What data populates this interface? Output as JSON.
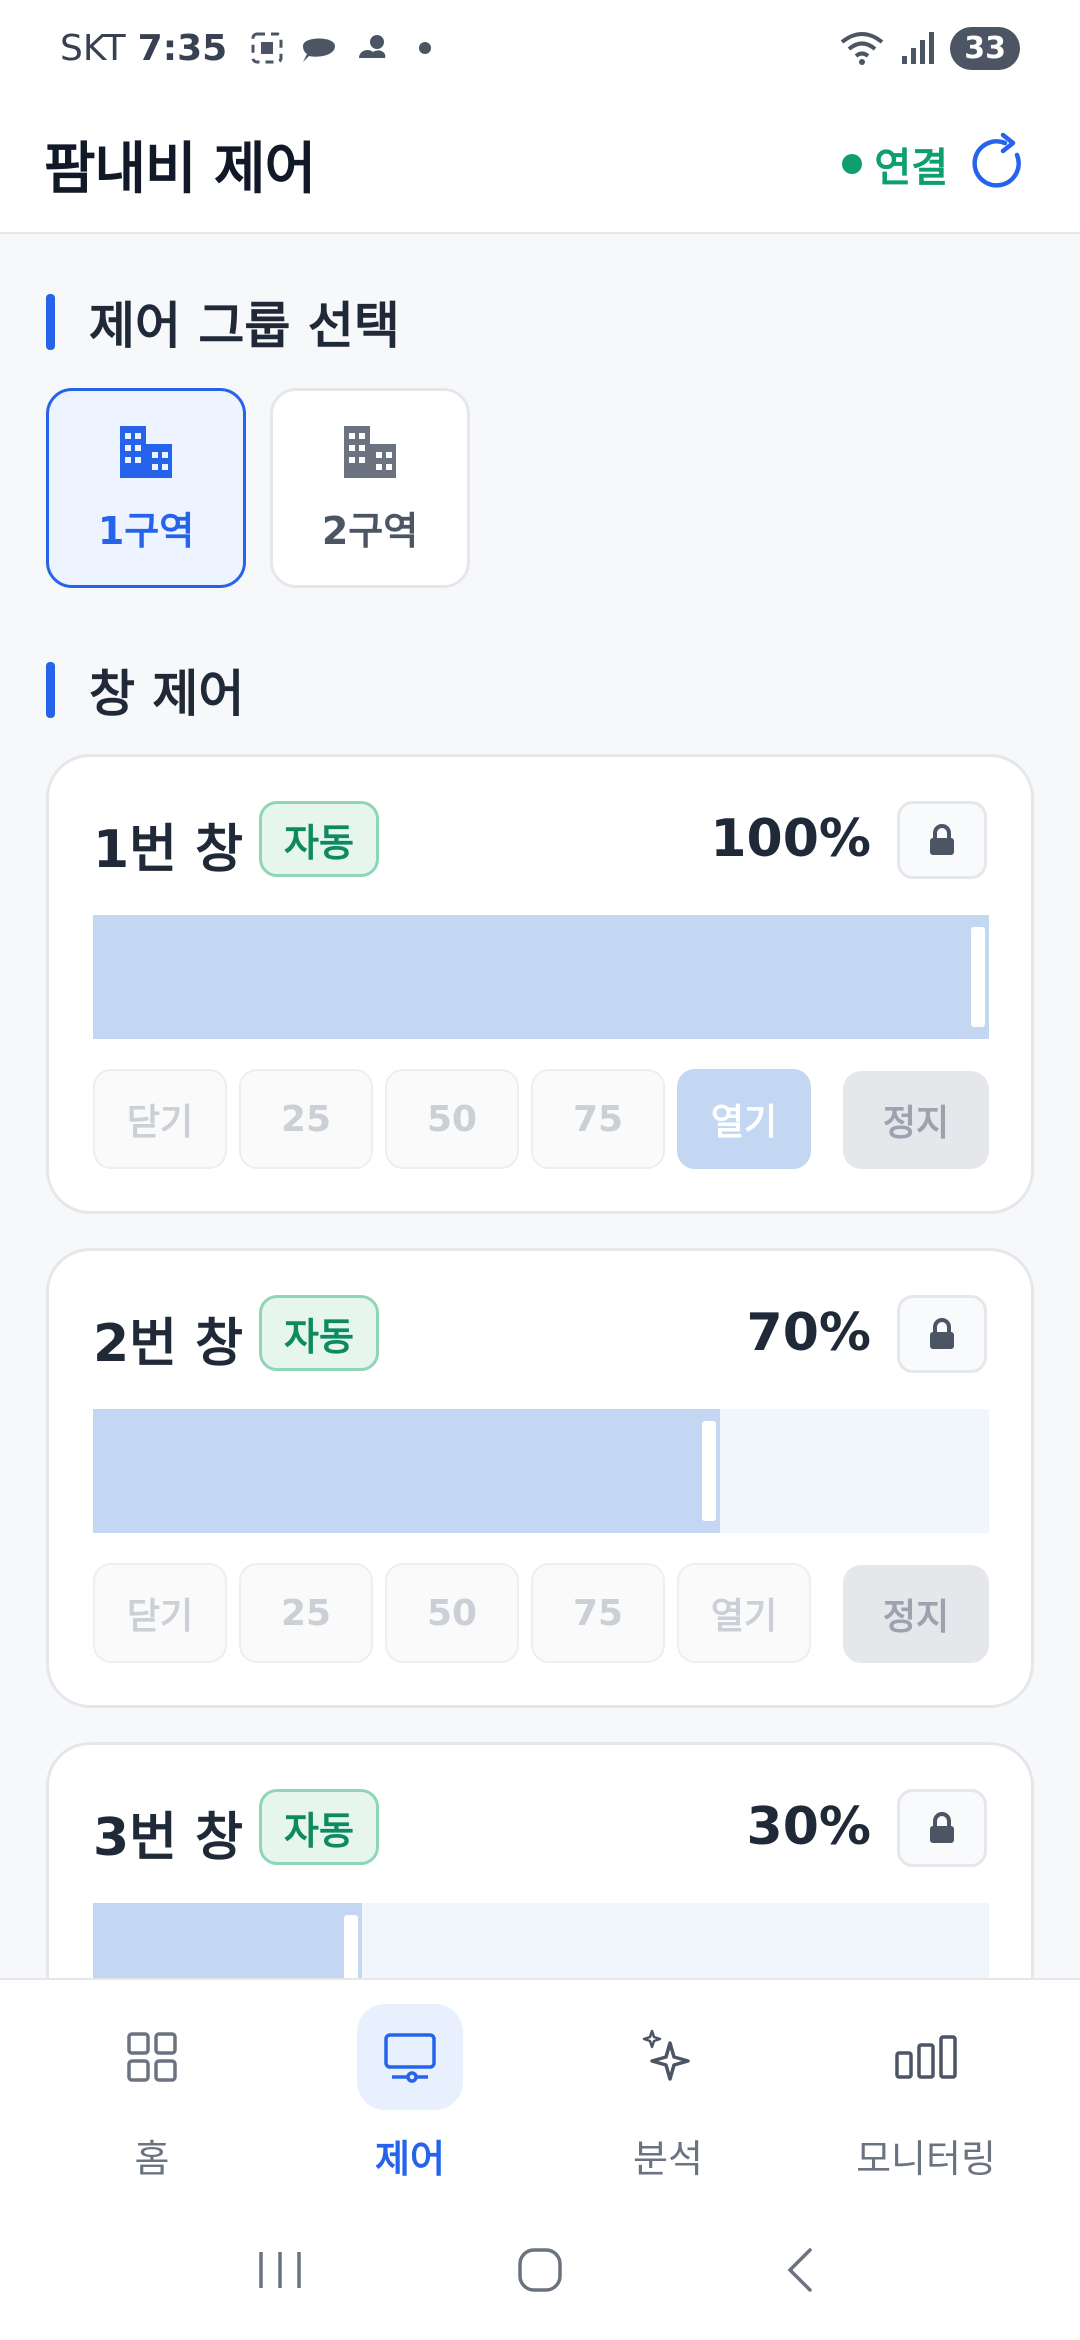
{
  "status_bar": {
    "carrier": "SKT",
    "time": "7:35",
    "battery": "33"
  },
  "header": {
    "title": "팜내비 제어",
    "connection_label": "연결",
    "connection_color": "#0e9f6e"
  },
  "group_section": {
    "title": "제어 그룹 선택",
    "zones": [
      {
        "label": "1구역",
        "selected": true
      },
      {
        "label": "2구역",
        "selected": false
      }
    ]
  },
  "window_section": {
    "title": "창 제어",
    "windows": [
      {
        "name": "1번 창",
        "mode": "자동",
        "percent_label": "100%",
        "open_fraction": 1.0
      },
      {
        "name": "2번 창",
        "mode": "자동",
        "percent_label": "70%",
        "open_fraction": 0.7
      },
      {
        "name": "3번 창",
        "mode": "자동",
        "percent_label": "30%",
        "open_fraction": 0.3
      }
    ],
    "position_buttons": [
      "닫기",
      "25",
      "50",
      "75",
      "열기"
    ],
    "stop_label": "정지"
  },
  "bottom_nav": {
    "items": [
      {
        "label": "홈",
        "icon": "grid-icon"
      },
      {
        "label": "제어",
        "icon": "monitor-icon",
        "active": true
      },
      {
        "label": "분석",
        "icon": "sparkle-icon"
      },
      {
        "label": "모니터링",
        "icon": "bar-chart-icon"
      }
    ]
  },
  "colors": {
    "accent": "#2563eb",
    "fill": "#c4d7f2",
    "auto_badge": "#0e8a5f"
  }
}
